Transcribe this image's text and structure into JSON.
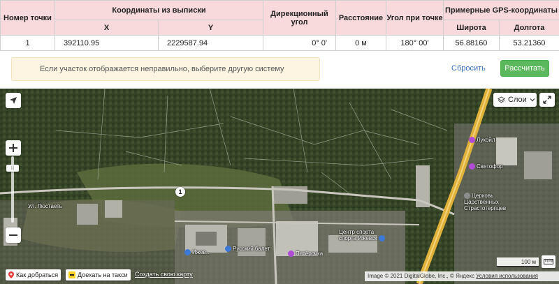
{
  "table": {
    "headers": {
      "point_number": "Номер точки",
      "coords": "Координаты из выписки",
      "x": "X",
      "y": "Y",
      "bearing": "Дирекционный угол",
      "distance": "Расстояние",
      "angle": "Угол при точке",
      "gps": "Примерные GPS-координаты",
      "lat": "Широта",
      "lon": "Долгота"
    },
    "rows": [
      {
        "num": "1",
        "x": "392110.95",
        "y": "2229587.94",
        "bearing": "0° 0'",
        "distance": "0 м",
        "angle": "180° 00'",
        "lat": "56.88160",
        "lon": "53.21360"
      }
    ]
  },
  "notice": {
    "text": "Если участок отображается неправильно, выберите другую систему координат."
  },
  "actions": {
    "reset_label": "Сбросить",
    "calculate_label": "Рассчитать"
  },
  "map": {
    "layers_label": "Слои",
    "marker_label": "1",
    "zoom_knob_label": "|||",
    "pois": {
      "lukoil": "Лукойл",
      "svetofor": "Светофор",
      "church_1": "Церковь",
      "church_2": "Царственных",
      "church_3": "Страстотерпцев",
      "sport_1": "Центр спорта",
      "sport_2": "спорта Ижевск",
      "ballet": "Русский балет",
      "pyaterochka": "Пятёрочка",
      "house_label": "Ижев...",
      "street": "Ул. Люстаеть"
    },
    "route_label": "Как добраться",
    "taxi_label": "Доехать на такси",
    "create_map_label": "Создать свою карту",
    "copyright_text": "Image © 2021 DigitalGlobe, Inc., © Яндекс",
    "terms_label": "Условия использования",
    "scale_label": "100 м"
  },
  "colors": {
    "header_bg": "#f8d9dc",
    "notice_bg": "#fdf5e2",
    "accent_green": "#5cb85c",
    "link_blue": "#3b6fbd"
  }
}
